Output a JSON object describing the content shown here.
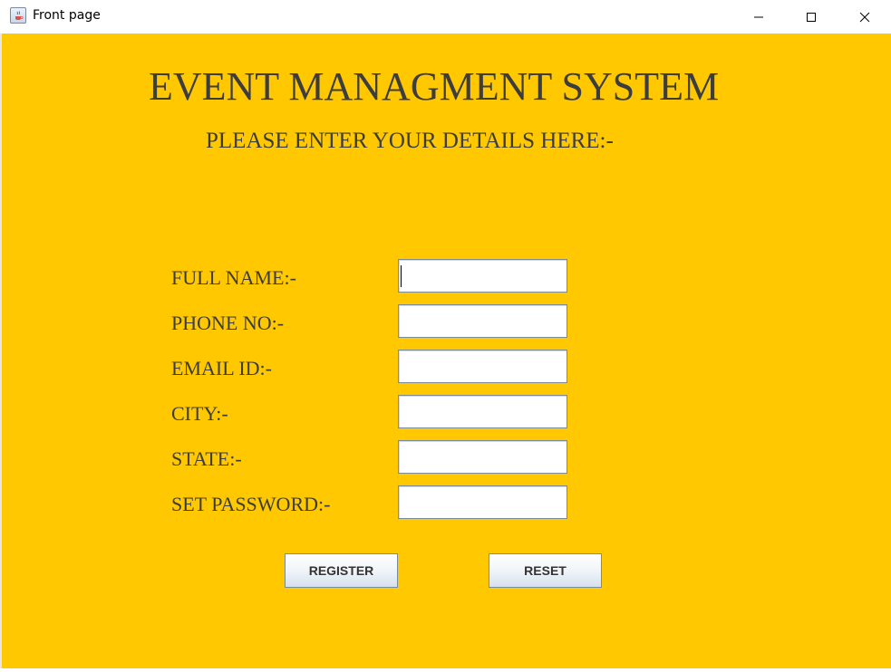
{
  "window": {
    "title": "Front page",
    "controls": {
      "minimize": "minimize",
      "maximize": "maximize",
      "close": "close"
    }
  },
  "colors": {
    "background": "#ffc800",
    "text": "#3d3d3d"
  },
  "form": {
    "heading": "EVENT MANAGMENT SYSTEM",
    "subheading": "PLEASE ENTER YOUR DETAILS HERE:-",
    "fields": [
      {
        "label": "FULL NAME:-",
        "value": ""
      },
      {
        "label": "PHONE NO:-",
        "value": ""
      },
      {
        "label": "EMAIL ID:-",
        "value": ""
      },
      {
        "label": "CITY:-",
        "value": ""
      },
      {
        "label": "STATE:-",
        "value": ""
      },
      {
        "label": "SET PASSWORD:-",
        "value": ""
      }
    ],
    "buttons": {
      "register": "REGISTER",
      "reset": "RESET"
    }
  }
}
